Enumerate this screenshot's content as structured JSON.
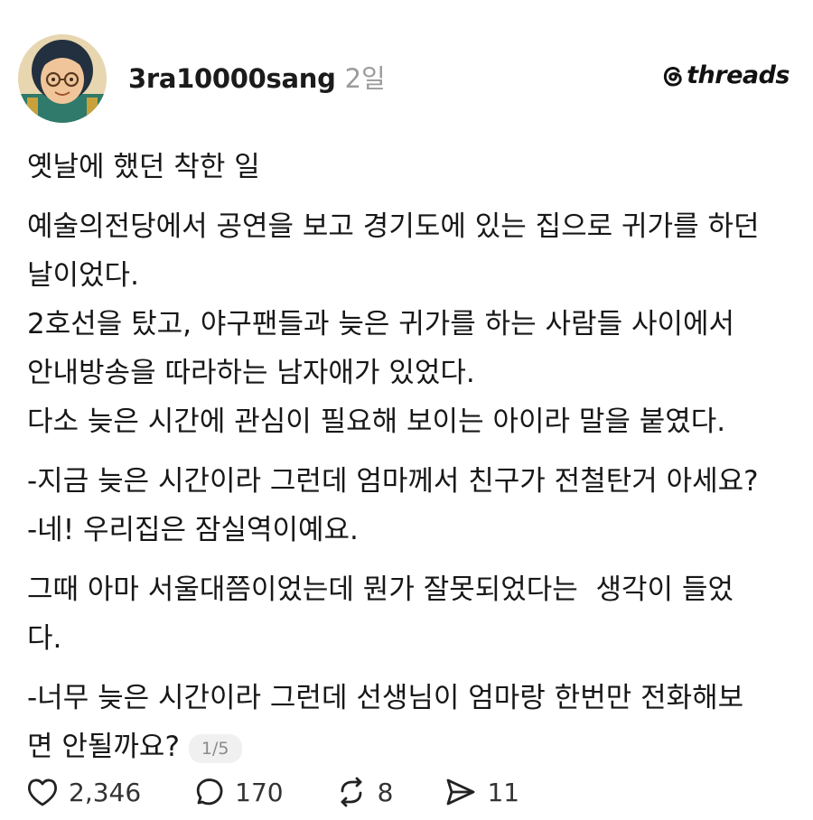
{
  "post": {
    "username": "3ra10000sang",
    "time": "2일",
    "brand": "threads",
    "lines": [
      {
        "text": "옛날에 했던 착한 일"
      },
      {
        "gap": true
      },
      {
        "text": "예술의전당에서 공연을 보고 경기도에 있는 집으로 귀가를 하던"
      },
      {
        "text": "날이었다."
      },
      {
        "text": "2호선을 탔고, 야구팬들과 늦은 귀가를 하는 사람들 사이에서"
      },
      {
        "text": "안내방송을 따라하는 남자애가 있었다."
      },
      {
        "text": "다소 늦은 시간에 관심이 필요해 보이는 아이라 말을 붙였다."
      },
      {
        "gap": true
      },
      {
        "text": "-지금 늦은 시간이라 그런데 엄마께서 친구가 전철탄거 아세요?"
      },
      {
        "text": "-네! 우리집은 잠실역이예요."
      },
      {
        "gap": true
      },
      {
        "text": "그때 아마 서울대쯤이었는데 뭔가 잘못되었다는  생각이 들었"
      },
      {
        "text": "다."
      },
      {
        "gap": true
      },
      {
        "text": "-너무 늦은 시간이라 그런데 선생님이 엄마랑 한번만 전화해보"
      },
      {
        "text": "면 안될까요?",
        "pager": "1/5"
      }
    ],
    "actions": {
      "likes": "2,346",
      "comments": "170",
      "reposts": "8",
      "shares": "11"
    }
  }
}
